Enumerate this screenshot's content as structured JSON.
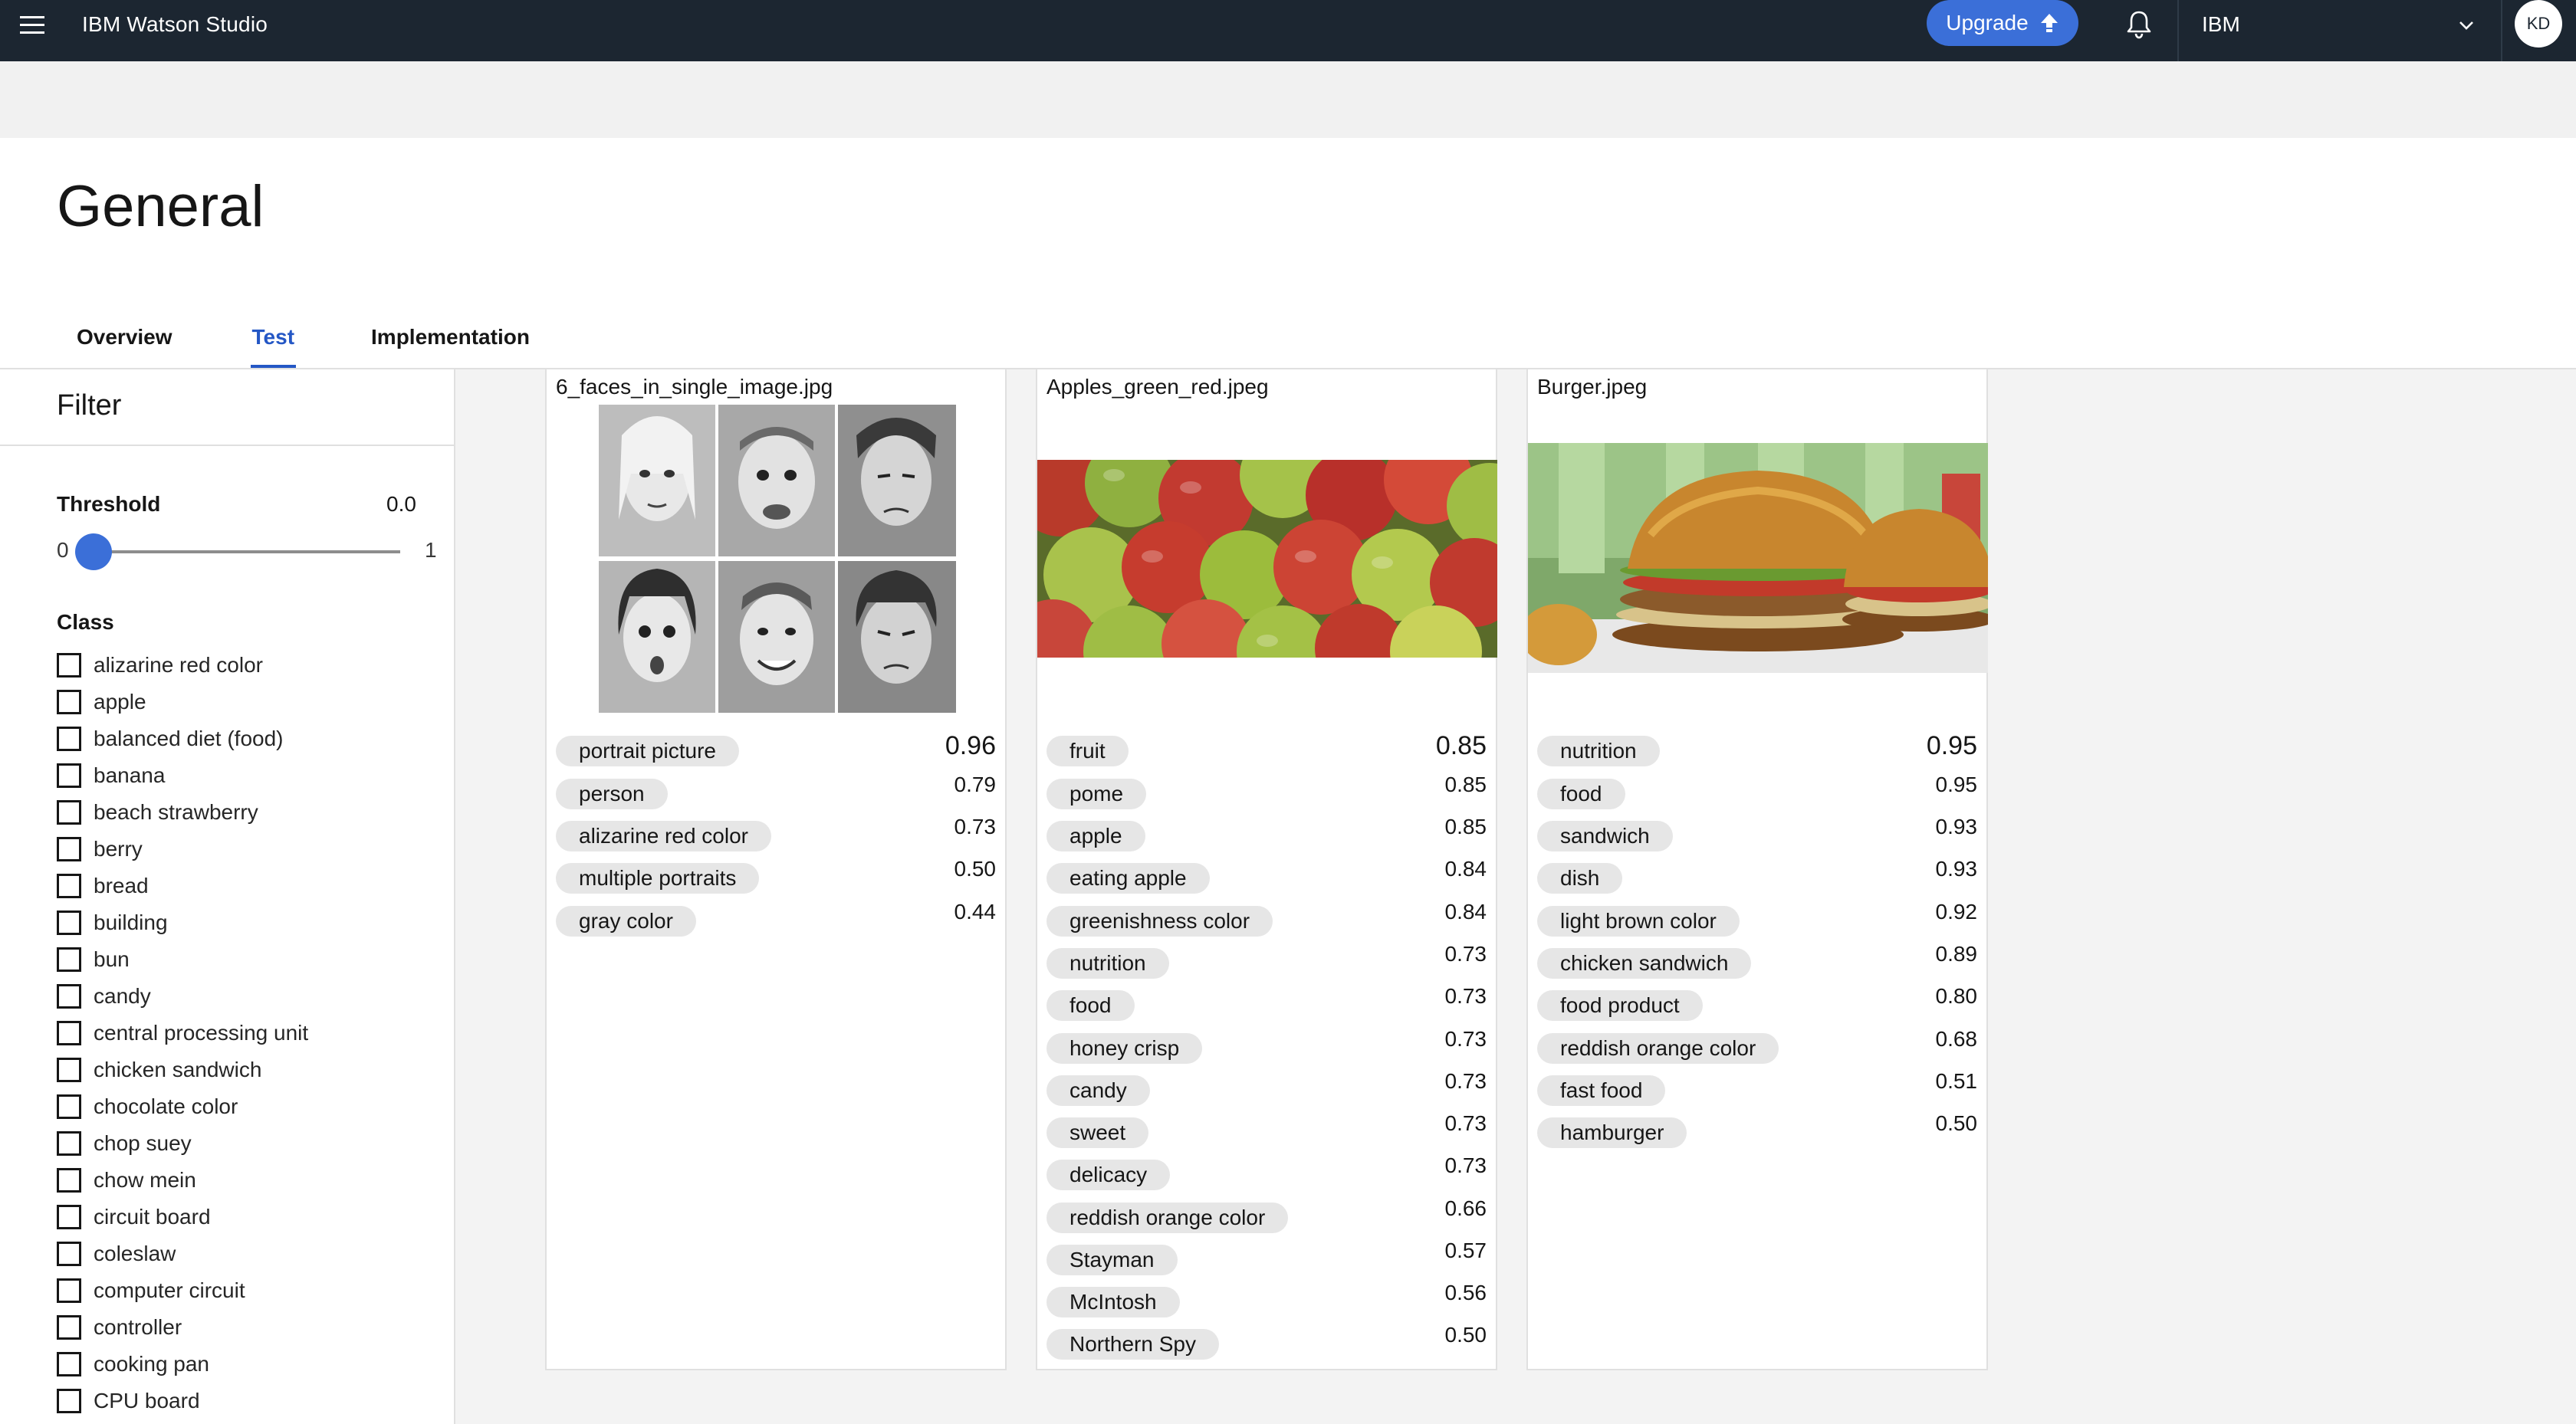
{
  "app": {
    "brand": "IBM Watson Studio",
    "upgrade_label": "Upgrade",
    "account": "IBM",
    "avatar_initials": "KD"
  },
  "page": {
    "title": "General"
  },
  "tabs": [
    {
      "label": "Overview"
    },
    {
      "label": "Test",
      "selected": true
    },
    {
      "label": "Implementation"
    }
  ],
  "filter": {
    "title": "Filter",
    "threshold_label": "Threshold",
    "threshold_value": "0.0",
    "slider_min": "0",
    "slider_max": "1",
    "class_label": "Class",
    "classes": [
      "alizarine red color",
      "apple",
      "balanced diet (food)",
      "banana",
      "beach strawberry",
      "berry",
      "bread",
      "building",
      "bun",
      "candy",
      "central processing unit",
      "chicken sandwich",
      "chocolate color",
      "chop suey",
      "chow mein",
      "circuit board",
      "coleslaw",
      "computer circuit",
      "controller",
      "cooking pan",
      "CPU board"
    ]
  },
  "cards": [
    {
      "filename": "6_faces_in_single_image.jpg",
      "results": [
        {
          "tag": "portrait picture",
          "score": "0.96"
        },
        {
          "tag": "person",
          "score": "0.79"
        },
        {
          "tag": "alizarine red color",
          "score": "0.73"
        },
        {
          "tag": "multiple portraits",
          "score": "0.50"
        },
        {
          "tag": "gray color",
          "score": "0.44"
        }
      ]
    },
    {
      "filename": "Apples_green_red.jpeg",
      "results": [
        {
          "tag": "fruit",
          "score": "0.85"
        },
        {
          "tag": "pome",
          "score": "0.85"
        },
        {
          "tag": "apple",
          "score": "0.85"
        },
        {
          "tag": "eating apple",
          "score": "0.84"
        },
        {
          "tag": "greenishness color",
          "score": "0.84"
        },
        {
          "tag": "nutrition",
          "score": "0.73"
        },
        {
          "tag": "food",
          "score": "0.73"
        },
        {
          "tag": "honey crisp",
          "score": "0.73"
        },
        {
          "tag": "candy",
          "score": "0.73"
        },
        {
          "tag": "sweet",
          "score": "0.73"
        },
        {
          "tag": "delicacy",
          "score": "0.73"
        },
        {
          "tag": "reddish orange color",
          "score": "0.66"
        },
        {
          "tag": "Stayman",
          "score": "0.57"
        },
        {
          "tag": "McIntosh",
          "score": "0.56"
        },
        {
          "tag": "Northern Spy",
          "score": "0.50"
        }
      ]
    },
    {
      "filename": "Burger.jpeg",
      "results": [
        {
          "tag": "nutrition",
          "score": "0.95"
        },
        {
          "tag": "food",
          "score": "0.95"
        },
        {
          "tag": "sandwich",
          "score": "0.93"
        },
        {
          "tag": "dish",
          "score": "0.93"
        },
        {
          "tag": "light brown color",
          "score": "0.92"
        },
        {
          "tag": "chicken sandwich",
          "score": "0.89"
        },
        {
          "tag": "food product",
          "score": "0.80"
        },
        {
          "tag": "reddish orange color",
          "score": "0.68"
        },
        {
          "tag": "fast food",
          "score": "0.51"
        },
        {
          "tag": "hamburger",
          "score": "0.50"
        }
      ]
    }
  ],
  "colors": {
    "topbar": "#1c2631",
    "accent": "#2457c5",
    "upgrade": "#3b6fd8",
    "tag_bg": "#e6e6e6"
  }
}
